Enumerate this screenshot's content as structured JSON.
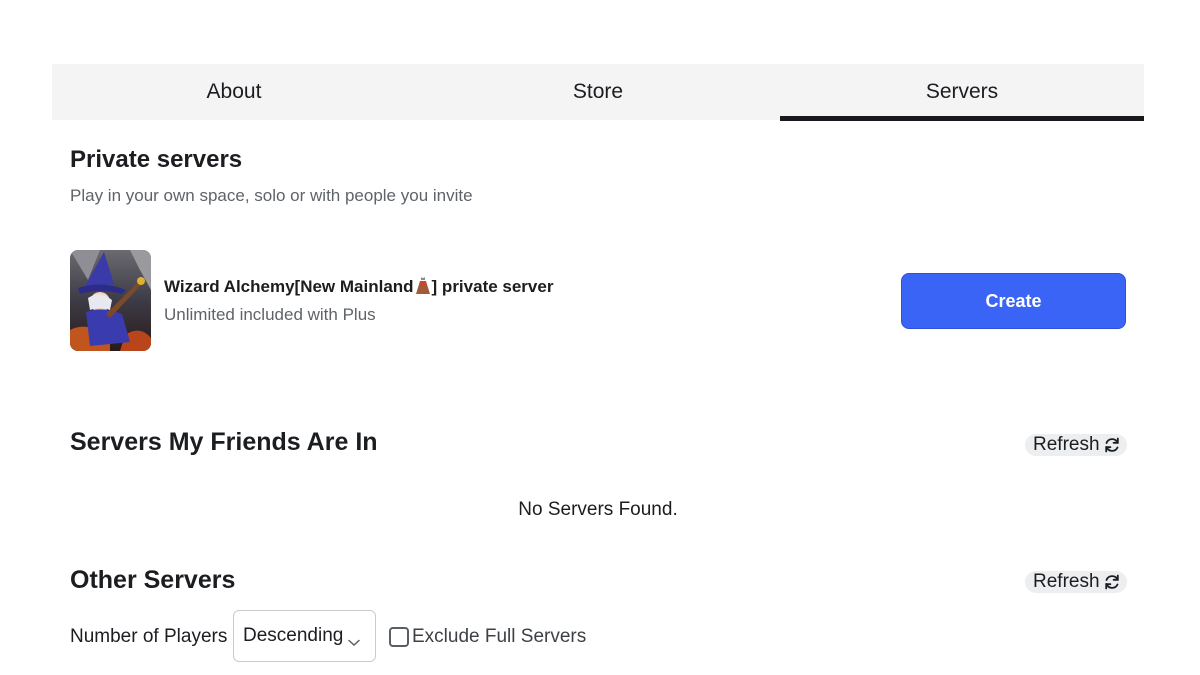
{
  "tabs": [
    {
      "label": "About",
      "active": false
    },
    {
      "label": "Store",
      "active": false
    },
    {
      "label": "Servers",
      "active": true
    }
  ],
  "private_servers": {
    "title": "Private servers",
    "subtitle": "Play in your own space, solo or with people you invite",
    "server": {
      "name_before": "Wizard Alchemy[New Mainland",
      "name_icon": "volcano-emoji-icon",
      "name_after": "] private server",
      "subtitle": "Unlimited included with Plus",
      "thumbnail_icon": "wizard-game-thumbnail"
    },
    "create_label": "Create"
  },
  "friends_servers": {
    "title": "Servers My Friends Are In",
    "refresh_label": "Refresh",
    "empty_text": "No Servers Found."
  },
  "other_servers": {
    "title": "Other Servers",
    "refresh_label": "Refresh",
    "sort_label": "Number of Players",
    "sort_value": "Descending",
    "exclude_label": "Exclude Full Servers",
    "exclude_checked": false
  },
  "colors": {
    "accent": "#3a64f5",
    "active_tab_underline": "#18191c",
    "tab_bar_bg": "#f4f4f5",
    "refresh_bg": "#eceef0"
  }
}
